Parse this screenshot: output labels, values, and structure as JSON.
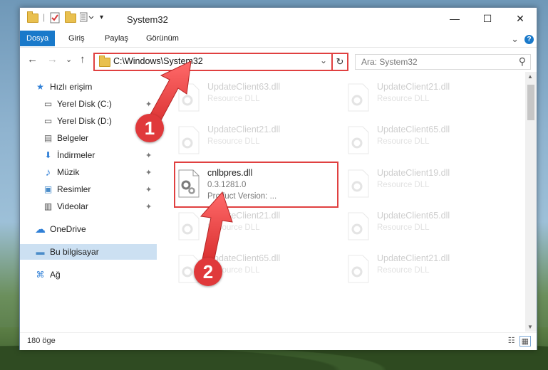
{
  "window": {
    "title": "System32",
    "controls": {
      "minimize": "—",
      "maximize": "☐",
      "close": "✕"
    }
  },
  "ribbon": {
    "tabs": [
      "Dosya",
      "Giriş",
      "Paylaş",
      "Görünüm"
    ],
    "active_tab": "Dosya",
    "expand_glyph": "⌄",
    "help_glyph": "?"
  },
  "address": {
    "path": "C:\\Windows\\System32",
    "dropdown_glyph": "⌄",
    "refresh_glyph": "↻"
  },
  "nav_buttons": {
    "back": "←",
    "forward": "→",
    "recent": "⌄",
    "up": "↑"
  },
  "search": {
    "placeholder": "Ara: System32",
    "icon": "search-icon",
    "glyph": "⚲"
  },
  "sidebar": {
    "items": [
      {
        "label": "Hızlı erişim",
        "icon": "star-icon",
        "glyph": "★",
        "pinned": false
      },
      {
        "label": "Yerel Disk (C:)",
        "icon": "drive-icon",
        "glyph": "▭",
        "pinned": true
      },
      {
        "label": "Yerel Disk (D:)",
        "icon": "drive-icon",
        "glyph": "▭",
        "pinned": true
      },
      {
        "label": "Belgeler",
        "icon": "documents-icon",
        "glyph": "▤",
        "pinned": true
      },
      {
        "label": "İndirmeler",
        "icon": "downloads-icon",
        "glyph": "⬇",
        "pinned": true
      },
      {
        "label": "Müzik",
        "icon": "music-icon",
        "glyph": "♪",
        "pinned": true
      },
      {
        "label": "Resimler",
        "icon": "pictures-icon",
        "glyph": "▣",
        "pinned": true
      },
      {
        "label": "Videolar",
        "icon": "videos-icon",
        "glyph": "▥",
        "pinned": true
      },
      {
        "label": "OneDrive",
        "icon": "cloud-icon",
        "glyph": "☁",
        "pinned": false
      },
      {
        "label": "Bu bilgisayar",
        "icon": "computer-icon",
        "glyph": "▬",
        "pinned": false
      },
      {
        "label": "Ağ",
        "icon": "network-icon",
        "glyph": "⌘",
        "pinned": false
      }
    ],
    "pin_glyph": "✦"
  },
  "files": [
    {
      "name": "UpdateClient63.dll",
      "desc": "Resource DLL",
      "faded": true
    },
    {
      "name": "UpdateClient21.dll",
      "desc": "Resource DLL",
      "faded": true
    },
    {
      "name": "UpdateClient21.dll",
      "desc": "Resource DLL",
      "faded": true
    },
    {
      "name": "UpdateClient65.dll",
      "desc": "Resource DLL",
      "faded": true
    },
    {
      "name": "cnlbpres.dll",
      "desc": "0.3.1281.0",
      "desc2": "Product Version:     ...",
      "faded": false
    },
    {
      "name": "UpdateClient19.dll",
      "desc": "Resource DLL",
      "faded": true
    },
    {
      "name": "UpdateClient21.dll",
      "desc": "Resource DLL",
      "faded": true
    },
    {
      "name": "UpdateClient65.dll",
      "desc": "Resource DLL",
      "faded": true
    },
    {
      "name": "UpdateClient65.dll",
      "desc": "Resource DLL",
      "faded": true
    },
    {
      "name": "UpdateClient21.dll",
      "desc": "Resource DLL",
      "faded": true
    }
  ],
  "status": {
    "count": "180 öge"
  },
  "annotations": [
    {
      "label": "1",
      "color": "#e0393b"
    },
    {
      "label": "2",
      "color": "#e0393b"
    }
  ]
}
